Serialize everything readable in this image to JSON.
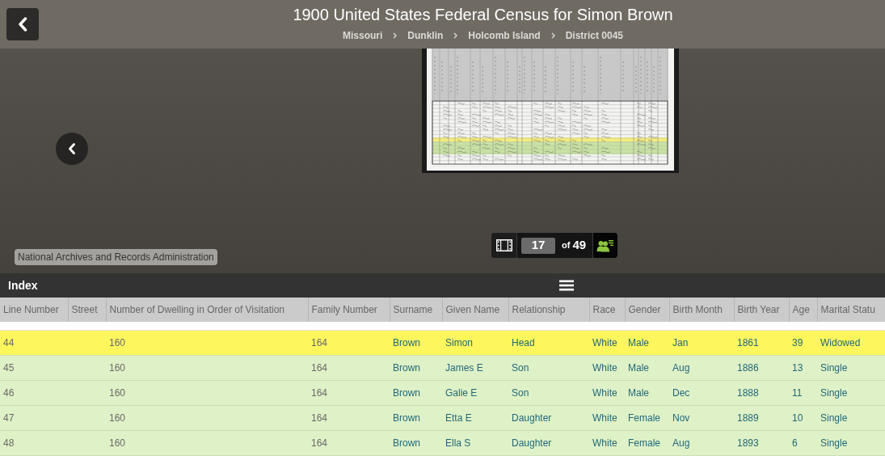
{
  "header": {
    "title": "1900 United States Federal Census for Simon Brown",
    "breadcrumbs": [
      "Missouri",
      "Dunklin",
      "Holcomb Island",
      "District 0045"
    ]
  },
  "viewer": {
    "source_label": "National Archives and Records Administration",
    "pager": {
      "current": "17",
      "of_text": "of",
      "total": "49"
    }
  },
  "index": {
    "title": "Index",
    "columns": [
      {
        "label": "Line Number",
        "kind": "record"
      },
      {
        "label": "Street",
        "kind": "record"
      },
      {
        "label": "Number of Dwelling in Order of Visitation",
        "kind": "record"
      },
      {
        "label": "Family Number",
        "kind": "record"
      },
      {
        "label": "Surname",
        "kind": "person"
      },
      {
        "label": "Given Name",
        "kind": "person"
      },
      {
        "label": "Relationship",
        "kind": "person"
      },
      {
        "label": "Race",
        "kind": "person"
      },
      {
        "label": "Gender",
        "kind": "person"
      },
      {
        "label": "Birth Month",
        "kind": "person"
      },
      {
        "label": "Birth Year",
        "kind": "person"
      },
      {
        "label": "Age",
        "kind": "person"
      },
      {
        "label": "Marital Statu",
        "kind": "person"
      }
    ],
    "rows": [
      {
        "selected": true,
        "cells": [
          "44",
          null,
          "160",
          "164",
          "Brown",
          "Simon",
          "Head",
          "White",
          "Male",
          "Jan",
          "1861",
          "39",
          "Widowed"
        ]
      },
      {
        "selected": false,
        "cells": [
          "45",
          null,
          "160",
          "164",
          "Brown",
          "James E",
          "Son",
          "White",
          "Male",
          "Aug",
          "1886",
          "13",
          "Single"
        ]
      },
      {
        "selected": false,
        "cells": [
          "46",
          null,
          "160",
          "164",
          "Brown",
          "Galie E",
          "Son",
          "White",
          "Male",
          "Dec",
          "1888",
          "11",
          "Single"
        ]
      },
      {
        "selected": false,
        "cells": [
          "47",
          null,
          "160",
          "164",
          "Brown",
          "Etta E",
          "Daughter",
          "White",
          "Female",
          "Nov",
          "1889",
          "10",
          "Single"
        ]
      },
      {
        "selected": false,
        "cells": [
          "48",
          null,
          "160",
          "164",
          "Brown",
          "Ella S",
          "Daughter",
          "White",
          "Female",
          "Aug",
          "1893",
          "6",
          "Single"
        ]
      }
    ]
  }
}
